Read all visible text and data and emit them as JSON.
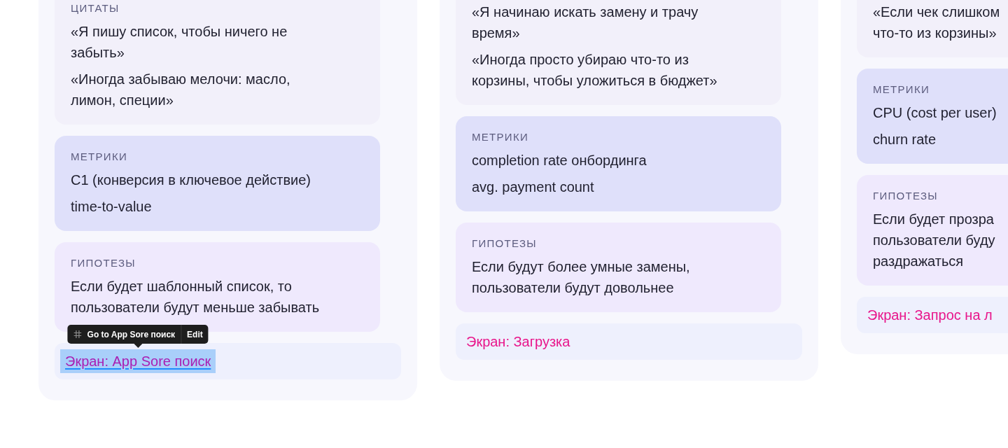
{
  "columns": [
    {
      "sections": [
        {
          "kind": "quotes",
          "label": "ЦИТАТЫ",
          "items": [
            "«Я пишу список, чтобы ничего не\nзабыть»",
            "«Иногда забываю мелочи: масло,\nлимон, специи»"
          ]
        },
        {
          "kind": "metrics",
          "label": "МЕТРИКИ",
          "items": [
            "C1 (конверсия в ключевое действие)",
            "time-to-value"
          ]
        },
        {
          "kind": "hypotheses",
          "label": "ГИПОТЕЗЫ",
          "items": [
            "Если будет шаблонный список, то\nпользователи будут меньше забывать"
          ]
        }
      ],
      "screen_link": {
        "text": "Экран: App Sore поиск",
        "selected": true,
        "tooltip": {
          "label": "Go to App Sore поиск",
          "action": "Edit"
        }
      }
    },
    {
      "sections": [
        {
          "kind": "quotes",
          "items": [
            "«Я начинаю искать замену и трачу\nвремя»",
            "«Иногда просто убираю что-то из\nкорзины, чтобы уложиться в бюджет»"
          ]
        },
        {
          "kind": "metrics",
          "label": "МЕТРИКИ",
          "items": [
            "completion rate онбординга",
            "avg. payment count"
          ]
        },
        {
          "kind": "hypotheses",
          "label": "ГИПОТЕЗЫ",
          "items": [
            "Если будут более умные замены,\nпользователи будут довольнее"
          ]
        }
      ],
      "screen_link": {
        "text": "Экран: Загрузка",
        "selected": false
      }
    },
    {
      "sections": [
        {
          "kind": "quotes",
          "items": [
            "«Если чек слишком\nчто-то из корзины»"
          ]
        },
        {
          "kind": "metrics",
          "label": "МЕТРИКИ",
          "items": [
            "CPU (cost per user)",
            "churn rate"
          ]
        },
        {
          "kind": "hypotheses",
          "label": "ГИПОТЕЗЫ",
          "items": [
            "Если будет прозра\nпользователи буду\nраздражаться"
          ]
        }
      ],
      "screen_link": {
        "text": "Экран: Запрос на л",
        "selected": false
      }
    }
  ]
}
